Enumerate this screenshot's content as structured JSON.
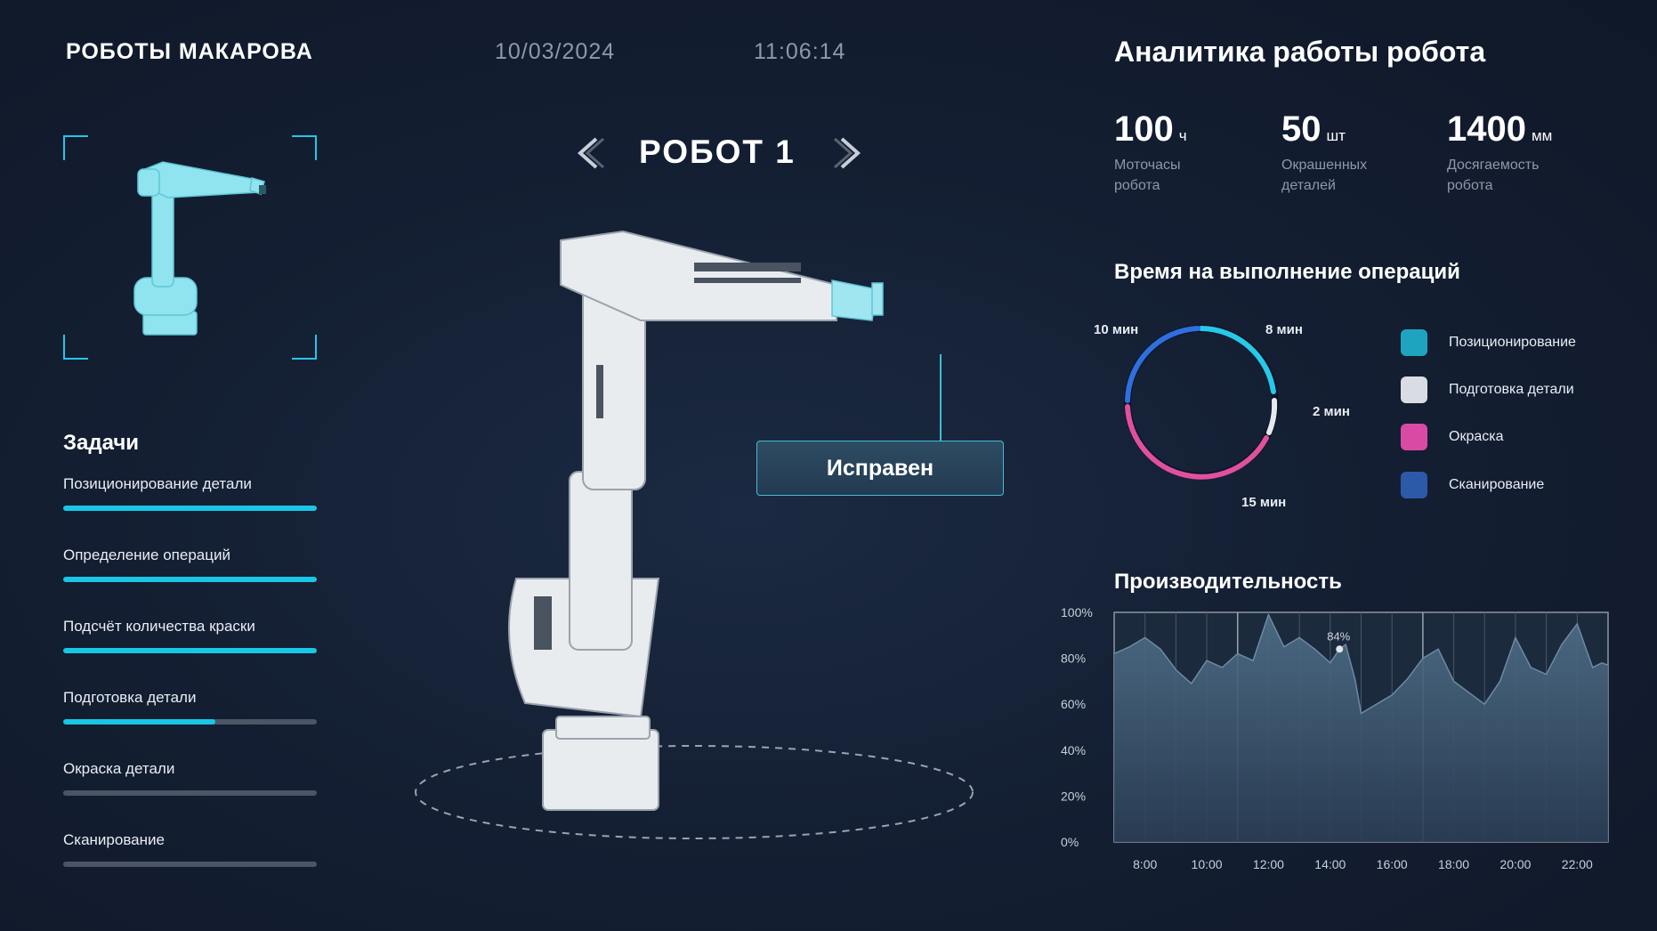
{
  "header": {
    "brand": "РОБОТЫ МАКАРОВА",
    "date": "10/03/2024",
    "time": "11:06:14"
  },
  "tasks": {
    "title": "Задачи",
    "items": [
      {
        "label": "Позиционирование детали",
        "progress": 1.0
      },
      {
        "label": "Определение операций",
        "progress": 1.0
      },
      {
        "label": "Подсчёт количества краски",
        "progress": 1.0
      },
      {
        "label": "Подготовка детали",
        "progress": 0.6
      },
      {
        "label": "Окраска детали",
        "progress": 0.0
      },
      {
        "label": "Сканирование",
        "progress": 0.0
      }
    ]
  },
  "robot": {
    "title": "РОБОТ 1",
    "status": "Исправен",
    "prev_icon": "chevron-left-icon",
    "next_icon": "chevron-right-icon"
  },
  "analytics": {
    "title": "Аналитика работы робота",
    "stats": [
      {
        "value": "100",
        "unit": "ч",
        "label": "Моточасы\nробота"
      },
      {
        "value": "50",
        "unit": "шт",
        "label": "Окрашенных\nдеталей"
      },
      {
        "value": "1400",
        "unit": "мм",
        "label": "Досягаемость\nробота"
      }
    ]
  },
  "operations": {
    "title": "Время на выполнение операций",
    "labels": {
      "a": "10 мин",
      "b": "8 мин",
      "c": "2 мин",
      "d": "15 мин"
    },
    "legend": [
      {
        "label": "Позиционирование",
        "color": "#1fa4c0"
      },
      {
        "label": "Подготовка детали",
        "color": "#d9dde3"
      },
      {
        "label": "Окраска",
        "color": "#d94aa5"
      },
      {
        "label": "Сканирование",
        "color": "#2c5aa8"
      }
    ]
  },
  "performance": {
    "title": "Производительность"
  },
  "chart_data": {
    "type": "area",
    "title": "Производительность",
    "x_ticks": [
      "8:00",
      "10:00",
      "12:00",
      "14:00",
      "16:00",
      "18:00",
      "20:00",
      "22:00"
    ],
    "y_ticks": [
      "100%",
      "80%",
      "60%",
      "40%",
      "20%",
      "0%"
    ],
    "ylim": [
      0,
      100
    ],
    "xlim": [
      7,
      23
    ],
    "grid": true,
    "annotation": {
      "x": 14.3,
      "y": 84,
      "label": "84%"
    },
    "x": [
      7,
      7.5,
      8,
      8.5,
      9,
      9.5,
      10,
      10.5,
      11,
      11.5,
      12,
      12.5,
      13,
      13.5,
      14,
      14.3,
      14.5,
      14.8,
      15,
      15.5,
      16,
      16.5,
      17,
      17.5,
      18,
      18.5,
      19,
      19.5,
      20,
      20.5,
      21,
      21.5,
      22,
      22.5,
      22.8,
      23
    ],
    "y": [
      82,
      85,
      89,
      84,
      75,
      69,
      79,
      76,
      82,
      79,
      99,
      85,
      89,
      84,
      78,
      84,
      86,
      71,
      56,
      60,
      64,
      71,
      80,
      84,
      70,
      65,
      60,
      70,
      89,
      76,
      73,
      86,
      95,
      76,
      78,
      77
    ]
  }
}
